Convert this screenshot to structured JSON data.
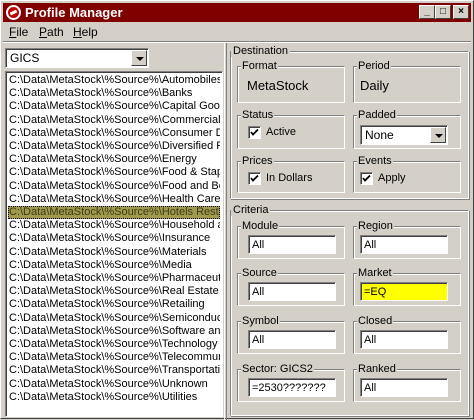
{
  "window": {
    "title": "Profile Manager",
    "buttons": {
      "minimize": "_",
      "maximize": "□",
      "close": "×"
    }
  },
  "menu": {
    "items": [
      {
        "label": "File",
        "accel": "F",
        "rest": "ile"
      },
      {
        "label": "Path",
        "accel": "P",
        "rest": "ath"
      },
      {
        "label": "Help",
        "accel": "H",
        "rest": "elp"
      }
    ]
  },
  "classification": {
    "selected": "GICS"
  },
  "paths": {
    "items": [
      "C:\\Data\\MetaStock\\%Source%\\Automobiles",
      "C:\\Data\\MetaStock\\%Source%\\Banks",
      "C:\\Data\\MetaStock\\%Source%\\Capital Goods",
      "C:\\Data\\MetaStock\\%Source%\\Commercial",
      "C:\\Data\\MetaStock\\%Source%\\Consumer D",
      "C:\\Data\\MetaStock\\%Source%\\Diversified F",
      "C:\\Data\\MetaStock\\%Source%\\Energy",
      "C:\\Data\\MetaStock\\%Source%\\Food & Stap",
      "C:\\Data\\MetaStock\\%Source%\\Food and Be",
      "C:\\Data\\MetaStock\\%Source%\\Health Care",
      "C:\\Data\\MetaStock\\%Source%\\Hotels Rest",
      "C:\\Data\\MetaStock\\%Source%\\Household a",
      "C:\\Data\\MetaStock\\%Source%\\Insurance",
      "C:\\Data\\MetaStock\\%Source%\\Materials",
      "C:\\Data\\MetaStock\\%Source%\\Media",
      "C:\\Data\\MetaStock\\%Source%\\Pharmaceut",
      "C:\\Data\\MetaStock\\%Source%\\Real Estate",
      "C:\\Data\\MetaStock\\%Source%\\Retailing",
      "C:\\Data\\MetaStock\\%Source%\\Semiconduc",
      "C:\\Data\\MetaStock\\%Source%\\Software an",
      "C:\\Data\\MetaStock\\%Source%\\Technology",
      "C:\\Data\\MetaStock\\%Source%\\Telecommun",
      "C:\\Data\\MetaStock\\%Source%\\Transportati",
      "C:\\Data\\MetaStock\\%Source%\\Unknown",
      "C:\\Data\\MetaStock\\%Source%\\Utilities"
    ],
    "selected_index": 10
  },
  "destination": {
    "title": "Destination",
    "format": {
      "label": "Format",
      "value": "MetaStock"
    },
    "period": {
      "label": "Period",
      "value": "Daily"
    },
    "status": {
      "label": "Status",
      "checkbox_label": "Active",
      "checked": true
    },
    "padded": {
      "label": "Padded",
      "value": "None"
    },
    "prices": {
      "label": "Prices",
      "checkbox_label": "In Dollars",
      "checked": true
    },
    "events": {
      "label": "Events",
      "checkbox_label": "Apply",
      "checked": true
    }
  },
  "criteria": {
    "title": "Criteria",
    "module": {
      "label": "Module",
      "value": "All"
    },
    "region": {
      "label": "Region",
      "value": "All"
    },
    "source": {
      "label": "Source",
      "value": "All"
    },
    "market": {
      "label": "Market",
      "value": "=EQ",
      "highlight": "#ffff00"
    },
    "symbol": {
      "label": "Symbol",
      "value": "All"
    },
    "closed": {
      "label": "Closed",
      "value": "All"
    },
    "sector": {
      "label": "Sector: GICS2",
      "value": "=2530???????"
    },
    "ranked": {
      "label": "Ranked",
      "value": "All"
    }
  },
  "colors": {
    "titlebar": "#800000",
    "face": "#d4d0c8",
    "selection": "#a09a4a",
    "highlight_field": "#ffff00"
  }
}
